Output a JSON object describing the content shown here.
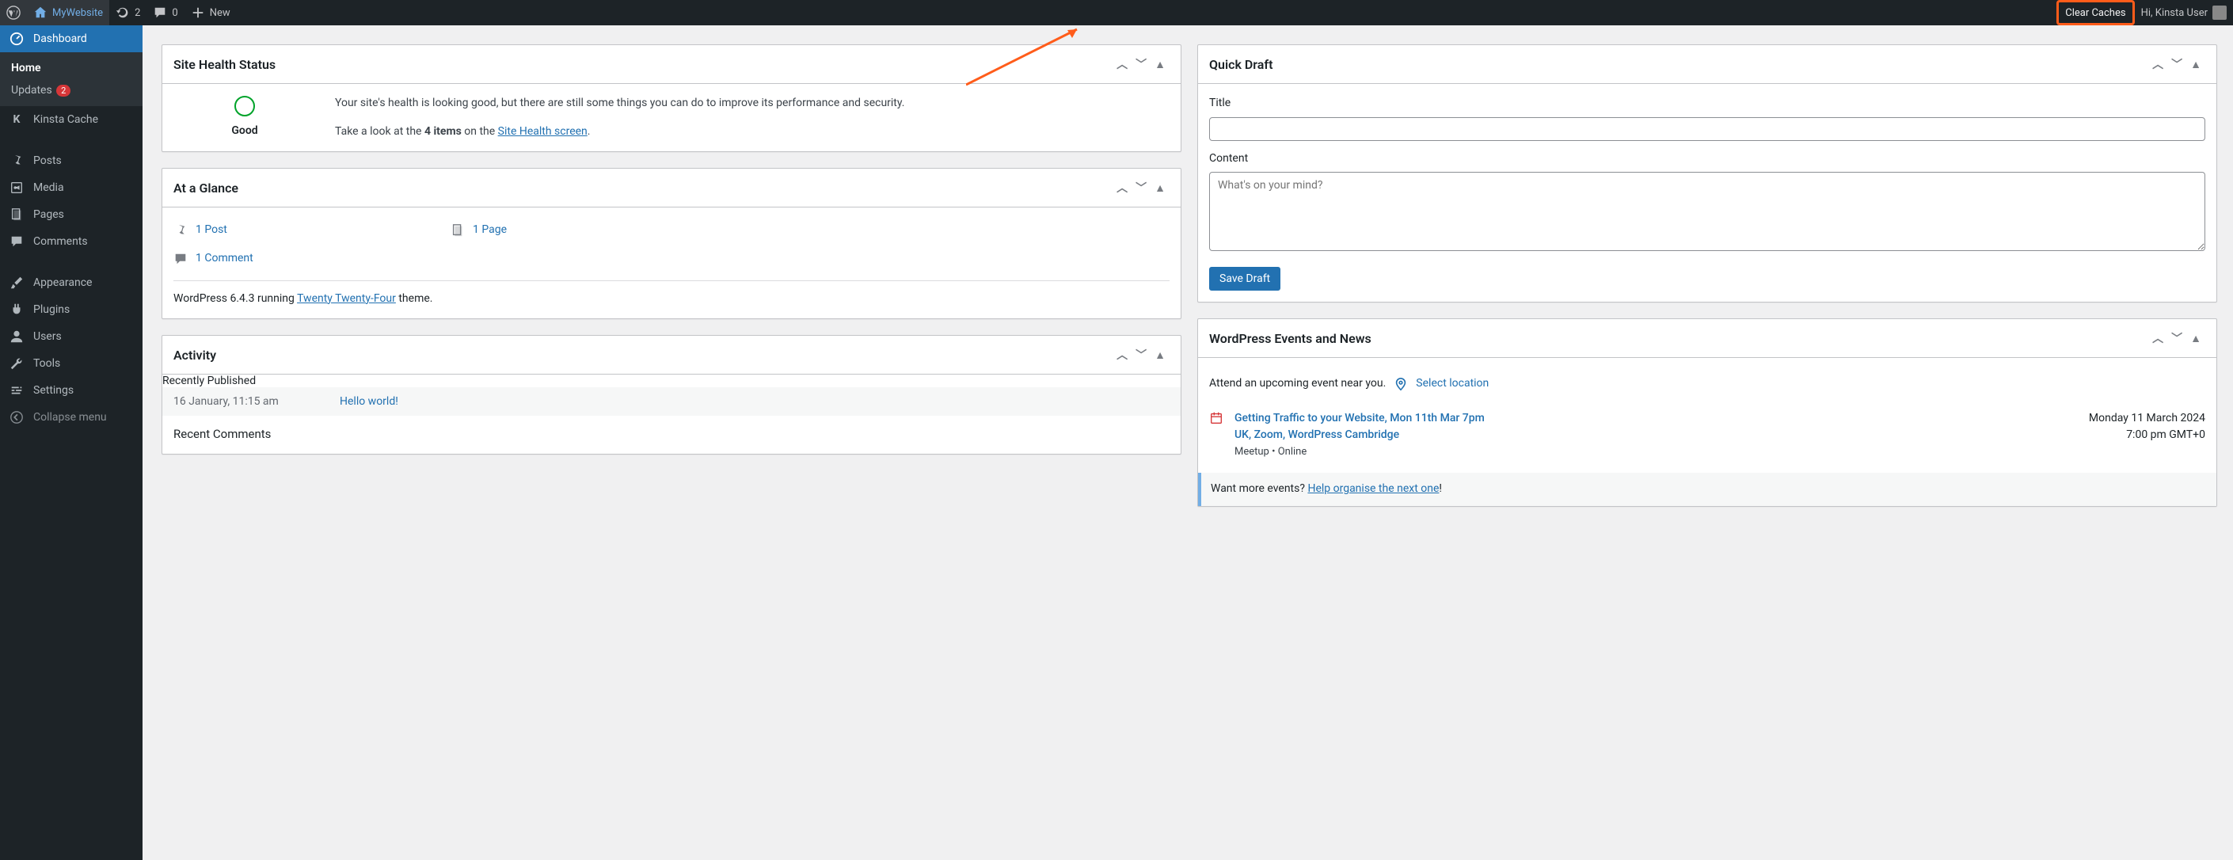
{
  "topbar": {
    "site_name": "MyWebsite",
    "updates_count": "2",
    "comments_count": "0",
    "new_label": "New",
    "clear_caches": "Clear Caches",
    "greeting": "Hi, Kinsta User"
  },
  "sidebar": {
    "dashboard": "Dashboard",
    "home": "Home",
    "updates": "Updates",
    "updates_badge": "2",
    "kinsta_cache": "Kinsta Cache",
    "posts": "Posts",
    "media": "Media",
    "pages": "Pages",
    "comments": "Comments",
    "appearance": "Appearance",
    "plugins": "Plugins",
    "users": "Users",
    "tools": "Tools",
    "settings": "Settings",
    "collapse": "Collapse menu"
  },
  "site_health": {
    "title": "Site Health Status",
    "status_label": "Good",
    "text": "Your site's health is looking good, but there are still some things you can do to improve its performance and security.",
    "cta1": "Take a look at the ",
    "bold": "4 items",
    "cta2": " on the ",
    "link": "Site Health screen",
    "period": "."
  },
  "glance": {
    "title": "At a Glance",
    "posts": "1 Post",
    "pages": "1 Page",
    "comments": "1 Comment",
    "wp1": "WordPress 6.4.3 running ",
    "theme_link": "Twenty Twenty-Four",
    "wp2": " theme."
  },
  "activity": {
    "title": "Activity",
    "recently_published": "Recently Published",
    "row_time": "16 January, 11:15 am",
    "row_link": "Hello world!",
    "recent_comments": "Recent Comments"
  },
  "quick_draft": {
    "title": "Quick Draft",
    "title_label": "Title",
    "content_label": "Content",
    "content_placeholder": "What's on your mind?",
    "save": "Save Draft"
  },
  "events": {
    "title": "WordPress Events and News",
    "attend": "Attend an upcoming event near you.",
    "select_location": "Select location",
    "item_title": "Getting Traffic to your Website, Mon 11th Mar 7pm UK, Zoom, WordPress Cambridge",
    "item_type": "Meetup • Online",
    "item_date": "Monday 11 March 2024",
    "item_time": "7:00 pm GMT+0",
    "want_more": "Want more events? ",
    "help_link": "Help organise the next one",
    "excl": "!"
  }
}
